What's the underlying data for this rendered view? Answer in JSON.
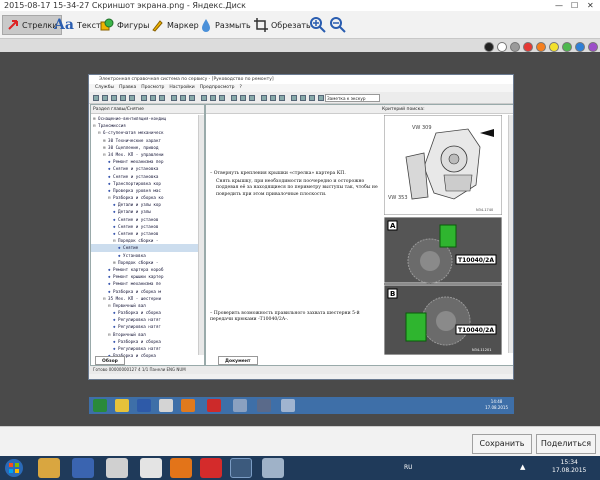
{
  "window_title": "2015-08-17 15-34-27 Скриншот экрана.png - Яндекс.Диск",
  "toolbar": {
    "tools": [
      {
        "label": "Стрелки",
        "icon": "arrow-icon"
      },
      {
        "label": "Текст",
        "icon": "text-icon"
      },
      {
        "label": "Фигуры",
        "icon": "shapes-icon"
      },
      {
        "label": "Маркер",
        "icon": "marker-icon"
      },
      {
        "label": "Размыть",
        "icon": "blur-icon"
      },
      {
        "label": "Обрезать",
        "icon": "crop-icon"
      }
    ],
    "active_tool": "Стрелки"
  },
  "palette": [
    "#222222",
    "#ffffff",
    "#9a9a9a",
    "#e53935",
    "#f57f1f",
    "#f3e12c",
    "#4fb84f",
    "#2f7fd6",
    "#9c4fc9"
  ],
  "inner_app": {
    "title": "Электронная справочная система по сервису - [Руководство по ремонту]",
    "menu": [
      "Службы",
      "Правка",
      "Просмотр",
      "Настройки",
      "Предпросмотр",
      "?"
    ],
    "note_label": "Заметка к экскур",
    "left_header": "Раздел главы/Снятие",
    "right_header": "Критерий поиска:",
    "tree": [
      "Оснащение-вентиляция-кондиц",
      "Трансмиссия",
      "6-ступенчатая механическ",
      "30 Технические характ",
      "30 Сцепление, привод",
      "34 Мех. КП - управлени",
      "Ремонт механизма пер",
      "Снятие и установка",
      "Снятие и установка",
      "Транспортировка кор",
      "Проверка уровня мас",
      "Разборка и сборка ко",
      "Детали и узлы кор",
      "Детали и узлы",
      "Снятие и установ",
      "Снятие и установ",
      "Снятие и установ",
      "Порядок сборки -",
      "Снятие",
      "Установка",
      "Порядок сборки -",
      "Ремонт картера короб",
      "Ремонт крышки картер",
      "Ремонт механизма пе",
      "Разборка и сборка м",
      "35 Мех. КП - шестерни",
      "Первичный вал",
      "Разборка и сборка",
      "Регулировка натяг",
      "Регулировка натяг",
      "Вторичный вал",
      "Разборка и сборка",
      "Регулировка натяг",
      "Разборка и сборка",
      "39 Главная передача,",
      "Ходовая часть"
    ],
    "left_tab": "Обзор",
    "doc_tab": "Документ",
    "instruction_1": "– Отвернуть крепления крышки «стрелка» картера КП.",
    "instruction_1b": "Снять крышку, при необходимости поочередно и осторожно поддевая её за находящиеся по периметру выступы так, чтобы не повредить при этом привалочные плоскости.",
    "instruction_2": "– Проверить возможность правильного захвата шестерни 5-й передачи крюками -Т10040/2А-.",
    "diagram_labels": {
      "vw309": "VW 309",
      "vw353": "VW 353",
      "code1": "N34-1740",
      "tool_a": "T10040/2A",
      "tool_b": "T10040/2A",
      "code2": "N34-11201",
      "a": "A",
      "b": "B"
    },
    "status_bar": "Готово                              00000000127                  4   1/1   Панели   ENG   NUM",
    "taskbar_clock": [
      "14:48",
      "17.08.2015"
    ]
  },
  "footer": {
    "save_label": "Сохранить",
    "share_label": "Поделиться"
  },
  "taskbar": {
    "lang": "RU",
    "time": "15:34",
    "date": "17.08.2015"
  }
}
